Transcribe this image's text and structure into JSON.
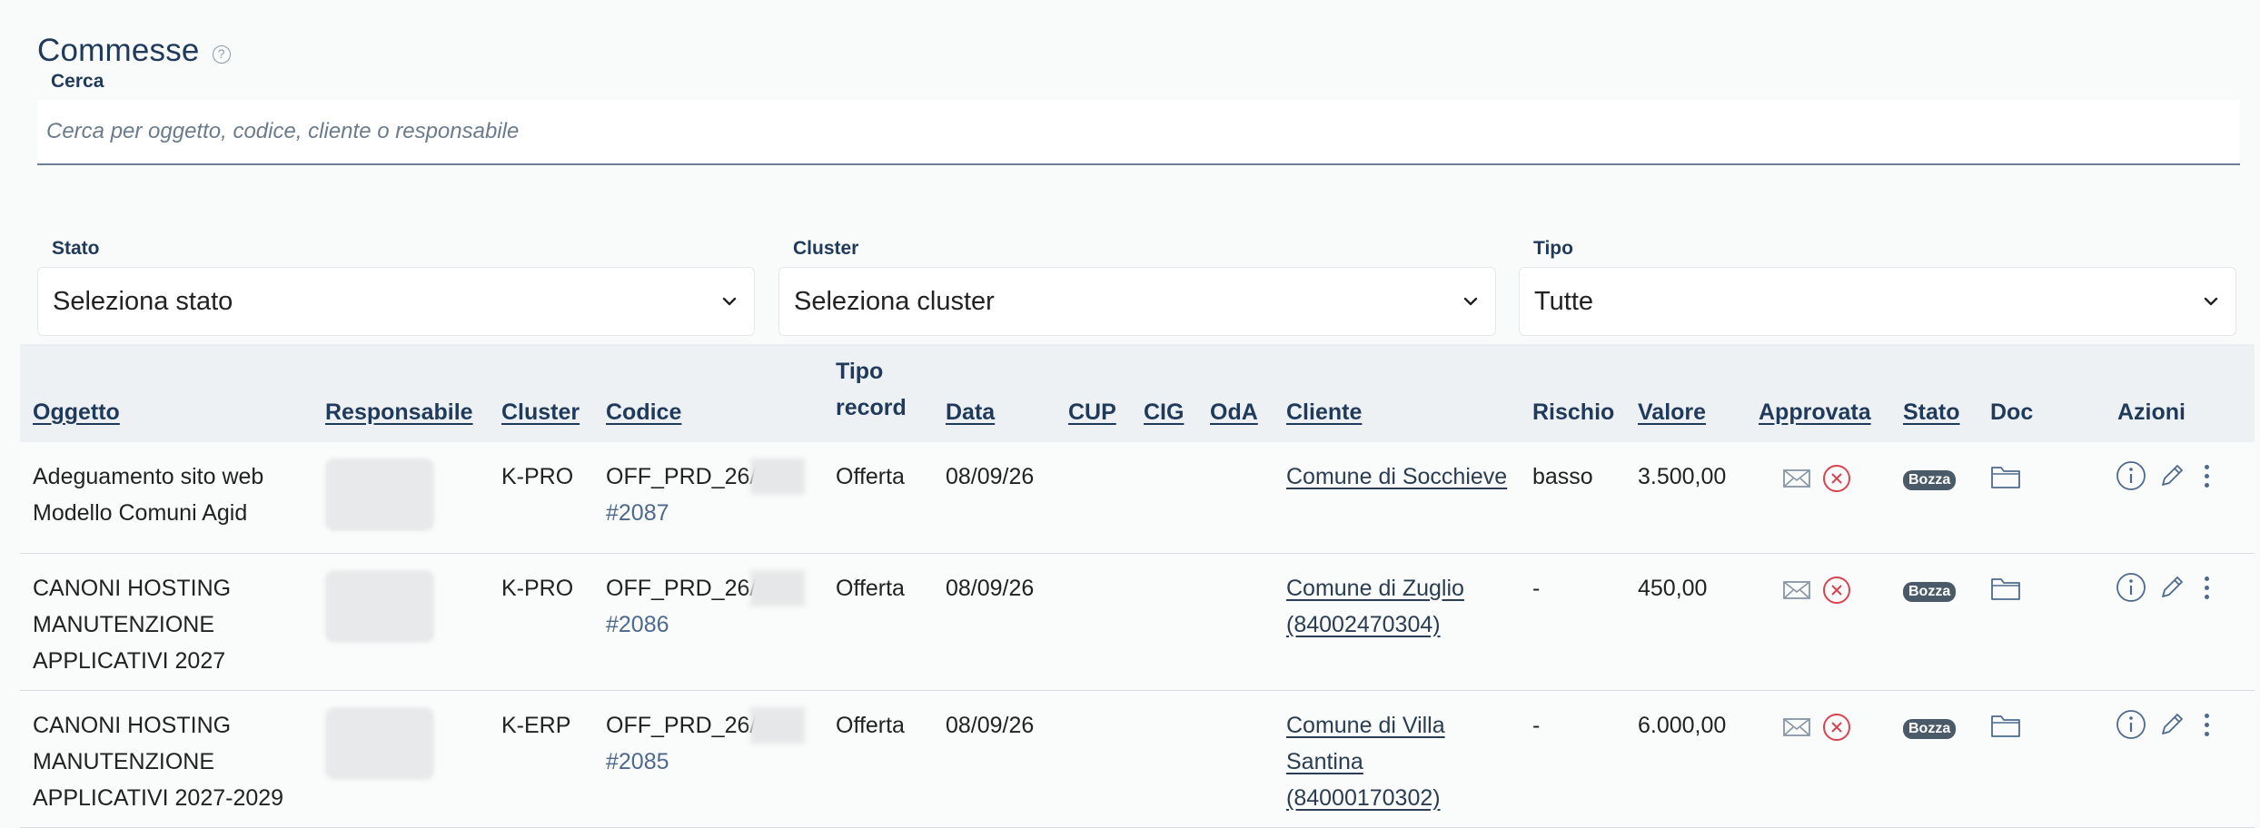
{
  "header": {
    "title": "Commesse"
  },
  "search": {
    "label": "Cerca",
    "placeholder": "Cerca per oggetto, codice, cliente o responsabile"
  },
  "filters": [
    {
      "label": "Stato",
      "value": "Seleziona stato"
    },
    {
      "label": "Cluster",
      "value": "Seleziona cluster"
    },
    {
      "label": "Tipo",
      "value": "Tutte"
    }
  ],
  "table": {
    "columns": [
      "Oggetto",
      "Responsabile",
      "Cluster",
      "Codice",
      "Tipo record",
      "Data",
      "CUP",
      "CIG",
      "OdA",
      "Cliente",
      "Rischio",
      "Valore",
      "Approvata",
      "Stato",
      "Doc",
      "Azioni"
    ],
    "rows": [
      {
        "oggetto": "Adeguamento sito web Modello Comuni Agid",
        "cluster": "K-PRO",
        "codice": "OFF_PRD_26/",
        "id": "#2087",
        "tipo": "Offerta",
        "data": "08/09/26",
        "cliente": "Comune di Socchieve",
        "rischio": "basso",
        "valore": "3.500,00",
        "stato": "Bozza"
      },
      {
        "oggetto": "CANONI HOSTING MANUTENZIONE APPLICATIVI 2027",
        "cluster": "K-PRO",
        "codice": "OFF_PRD_26/",
        "id": "#2086",
        "tipo": "Offerta",
        "data": "08/09/26",
        "cliente": "Comune di Zuglio (84002470304)",
        "rischio": "-",
        "valore": "450,00",
        "stato": "Bozza"
      },
      {
        "oggetto": "CANONI HOSTING MANUTENZIONE APPLICATIVI 2027-2029",
        "cluster": "K-ERP",
        "codice": "OFF_PRD_26/",
        "id": "#2085",
        "tipo": "Offerta",
        "data": "08/09/26",
        "cliente": "Comune di Villa Santina (84000170302)",
        "rischio": "-",
        "valore": "6.000,00",
        "stato": "Bozza"
      }
    ]
  },
  "icons": {
    "help": "help-circle-icon",
    "chevron": "chevron-down-icon",
    "mail": "mail-icon",
    "not_approved": "x-circle-icon",
    "folder": "folder-icon",
    "info": "info-icon",
    "edit": "pencil-icon",
    "more": "more-vertical-icon"
  },
  "colors": {
    "title": "#1f3a5a",
    "link": "#4d6a8e",
    "danger": "#d9434f",
    "badge": "#4b5a69"
  }
}
